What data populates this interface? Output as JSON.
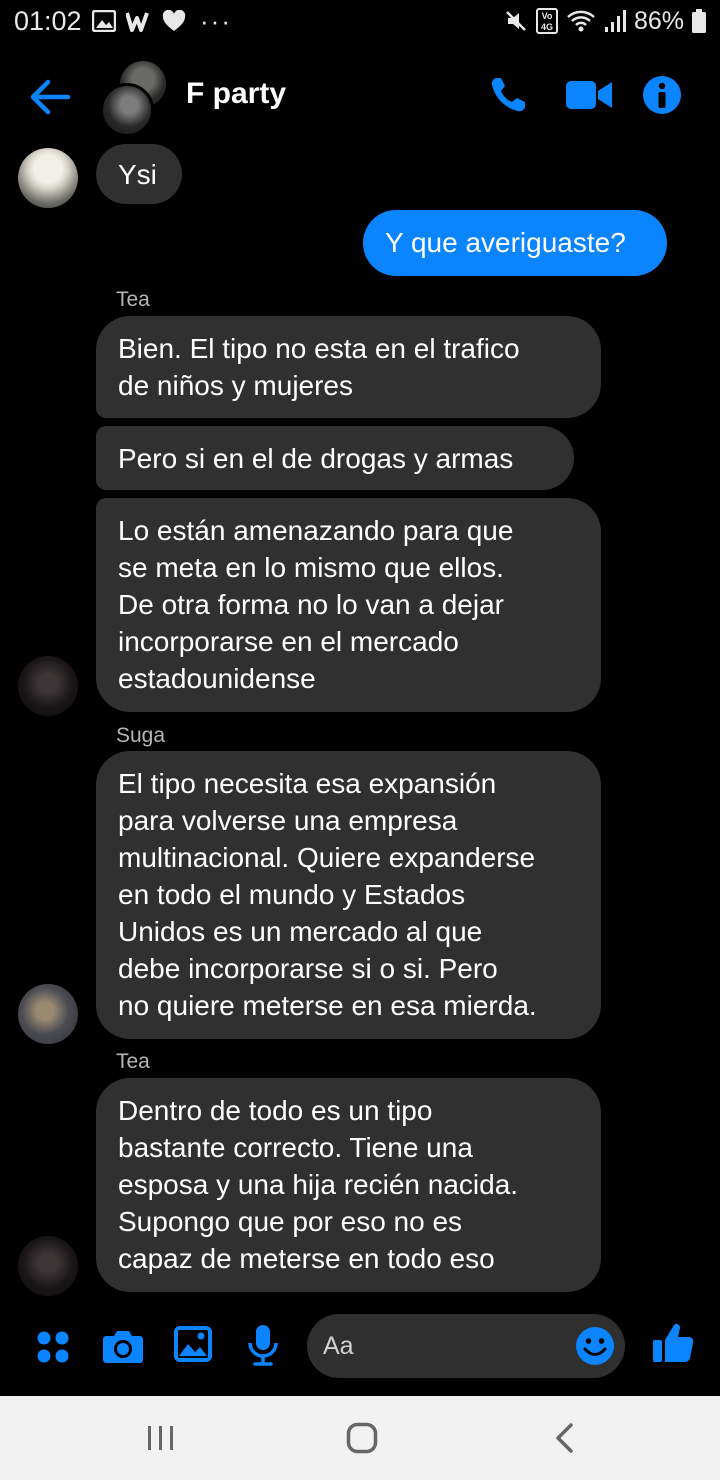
{
  "status_bar": {
    "time": "01:02",
    "battery": "86%",
    "left_icons": [
      "image-icon",
      "w-app-icon",
      "heart-icon",
      "more-dots-icon"
    ],
    "right_icons": [
      "mute-icon",
      "volte-icon",
      "wifi-icon",
      "signal-icon",
      "battery-icon"
    ],
    "volte_label": "Vo 4G",
    "dots": "···"
  },
  "header": {
    "title": "F party",
    "icons": [
      "back-arrow-icon",
      "phone-icon",
      "video-camera-icon",
      "info-icon"
    ]
  },
  "colors": {
    "accent": "#0a84ff",
    "background": "#000000",
    "incoming_bubble": "#303030",
    "outgoing_bubble": "#0a84ff"
  },
  "messages": [
    {
      "id": "m1",
      "direction": "incoming",
      "text": "Ysi"
    },
    {
      "id": "m2",
      "direction": "outgoing",
      "text": "Y que averiguaste?"
    },
    {
      "id": "m3",
      "direction": "incoming",
      "sender": "Tea",
      "text": "Bien. El tipo no esta en el trafico\nde niños y mujeres"
    },
    {
      "id": "m4",
      "direction": "incoming",
      "text": "Pero si en el de drogas y armas"
    },
    {
      "id": "m5",
      "direction": "incoming",
      "text": "Lo están amenazando para que\nse meta en lo mismo que ellos.\nDe otra forma no lo van a dejar\nincorporarse en el mercado\nestadounidense"
    },
    {
      "id": "m6",
      "direction": "incoming",
      "sender": "Suga",
      "text": "El tipo necesita esa expansión\npara volverse una empresa\nmultinacional. Quiere expanderse\nen todo el mundo y Estados\nUnidos es un mercado al que\ndebe incorporarse si o si. Pero\nno quiere meterse en esa mierda."
    },
    {
      "id": "m7",
      "direction": "incoming",
      "sender": "Tea",
      "text": "Dentro de todo es un tipo\nbastante correcto. Tiene una\nesposa y una hija recién nacida.\nSupongo que por eso no es\ncapaz de meterse en todo eso"
    }
  ],
  "composer": {
    "placeholder": "Aa",
    "icons": [
      "apps-grid-icon",
      "camera-icon",
      "gallery-icon",
      "microphone-icon",
      "emoji-icon",
      "thumbs-up-icon"
    ]
  },
  "nav_bar": {
    "icons": [
      "recent-apps-icon",
      "home-icon",
      "back-icon"
    ]
  }
}
